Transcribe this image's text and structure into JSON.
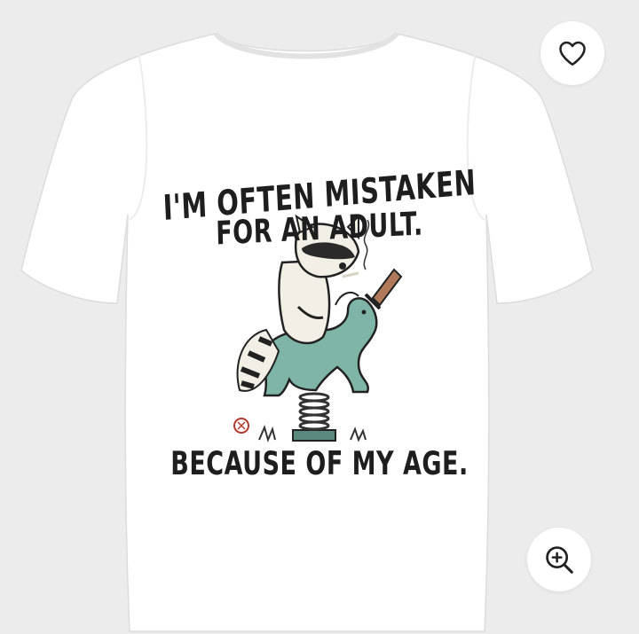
{
  "product_image": {
    "print_lines": [
      "I'M OFTEN MISTAKEN",
      "FOR AN ADULT.",
      "BECAUSE OF MY AGE."
    ]
  },
  "buttons": {
    "wishlist_icon": "heart-outline-icon",
    "zoom_icon": "zoom-in-icon"
  },
  "colors": {
    "background": "#ececec",
    "shirt": "#ffffff",
    "print_ink": "#1e1e1e",
    "horse": "#7fb5a6",
    "button_icon": "#222222"
  }
}
